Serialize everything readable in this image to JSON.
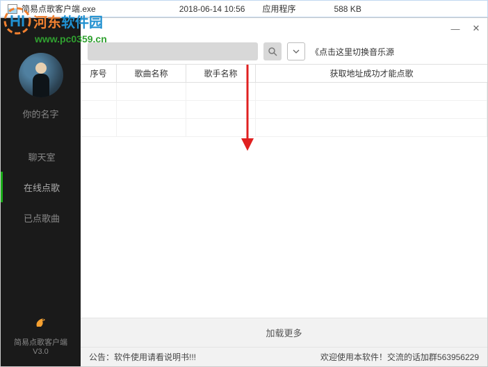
{
  "file_row": {
    "name": "简易点歌客户端.exe",
    "date": "2018-06-14 10:56",
    "type": "应用程序",
    "size": "588 KB"
  },
  "watermark": {
    "site_name_1": "河东",
    "site_name_2": "软件园",
    "url": "www.pc0359.cn"
  },
  "sidebar": {
    "user_name": "你的名字",
    "nav": [
      "聊天室",
      "在线点歌",
      "已点歌曲"
    ],
    "active_index": 1,
    "app_name": "简易点歌客户端",
    "version": "V3.0"
  },
  "search": {
    "placeholder": "",
    "hint": "《点击这里切换音乐源"
  },
  "table": {
    "headers": [
      "序号",
      "歌曲名称",
      "歌手名称",
      "获取地址成功才能点歌"
    ]
  },
  "load_more": "加载更多",
  "notice": {
    "left": "公告：软件使用请看说明书!!!",
    "right": "欢迎使用本软件！交流的话加群563956229"
  },
  "window_controls": {
    "min": "—",
    "close": "✕"
  }
}
